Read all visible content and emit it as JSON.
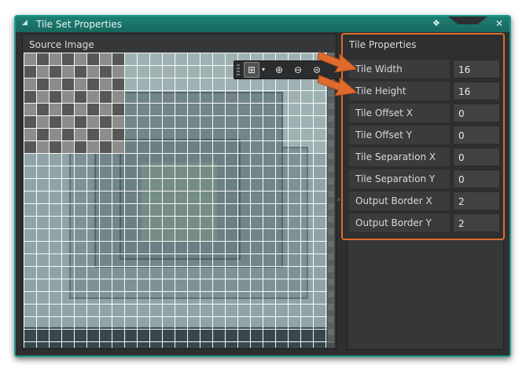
{
  "window": {
    "title": "Tile Set Properties",
    "collapse_glyph": "◢",
    "gem_glyph": "❖",
    "close_glyph": "✕"
  },
  "source": {
    "label": "Source Image"
  },
  "toolbar": {
    "grid_icon": "⊞",
    "dropdown_icon": "▾",
    "zoom_in_icon": "⊕",
    "zoom_out_icon": "⊖",
    "zoom_reset_icon": "⊜"
  },
  "splitter": {
    "glyph": "»"
  },
  "properties": {
    "title": "Tile Properties",
    "rows": [
      {
        "label": "Tile Width",
        "value": "16"
      },
      {
        "label": "Tile Height",
        "value": "16"
      },
      {
        "label": "Tile Offset X",
        "value": "0"
      },
      {
        "label": "Tile Offset Y",
        "value": "0"
      },
      {
        "label": "Tile Separation X",
        "value": "0"
      },
      {
        "label": "Tile Separation Y",
        "value": "0"
      },
      {
        "label": "Output Border X",
        "value": "2"
      },
      {
        "label": "Output Border Y",
        "value": "2"
      }
    ]
  },
  "colors": {
    "accent_teal": "#1f9b8c",
    "highlight_orange": "#e06b2c",
    "panel_bg": "#2e2f31"
  }
}
